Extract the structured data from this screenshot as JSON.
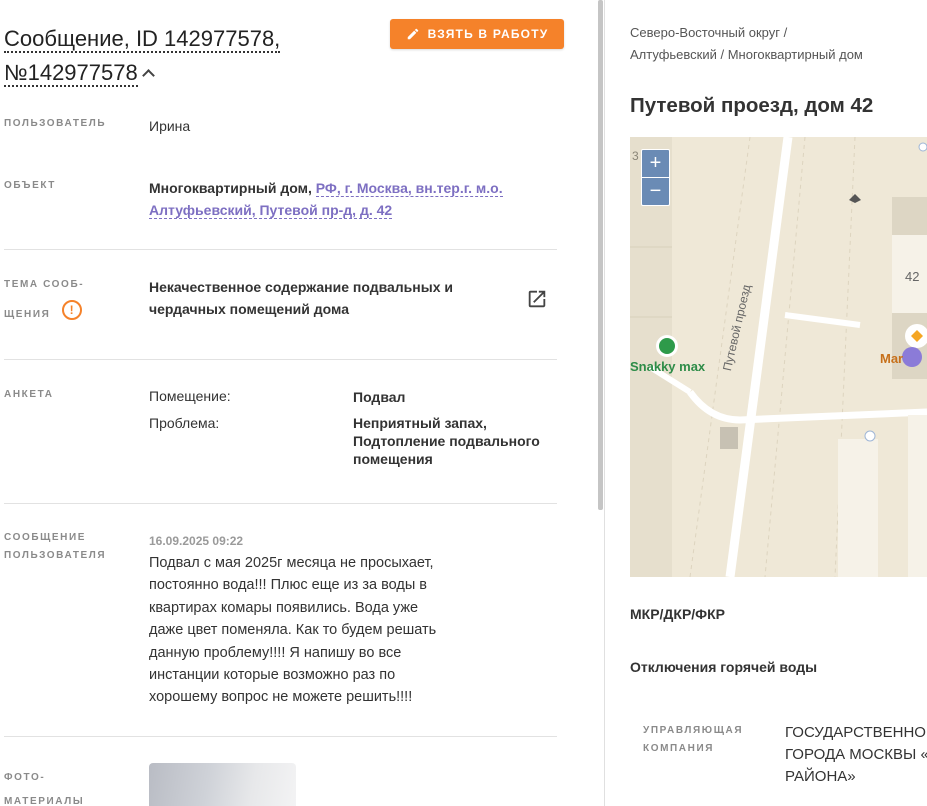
{
  "header": {
    "title_line1": "Сообщение, ID 142977578,",
    "title_line2": "№142977578",
    "take_button_label": "ВЗЯТЬ В РАБОТУ"
  },
  "fields": {
    "user_label": "ПОЛЬЗОВАТЕЛЬ",
    "user_value": "Ирина",
    "object_label": "ОБЪЕКТ",
    "object_type": "Многоквартирный дом,",
    "object_address_line1": "РФ, г. Москва, вн.тер.г. м.о.",
    "object_address_line2": "Алтуфьевский, Путевой пр-д, д. 42",
    "topic_label_line1": "ТЕМА СООБ-",
    "topic_label_line2": "ЩЕНИЯ",
    "topic_value_line1": "Некачественное содержание подвальных и",
    "topic_value_line2": "чердачных помещений дома",
    "anketa_label": "АНКЕТА",
    "anketa": [
      {
        "key": "Помещение:",
        "value": "Подвал"
      },
      {
        "key": "Проблема:",
        "value": "Неприятный запах, Подтопление подвального помещения"
      }
    ],
    "message_label_line1": "СООБЩЕНИЕ",
    "message_label_line2": "ПОЛЬЗОВАТЕЛЯ",
    "message_date": "16.09.2025 09:22",
    "message_text": "Подвал с мая 2025г месяца не просыхает, постоянно вода!!! Плюс еще из за воды в квартирах комары появились. Вода уже даже цвет поменяла. Как то будем решать данную проблему!!!! Я напишу во все инстанции которые возможно раз по хорошему вопрос не можете решить!!!!",
    "photo_label_line1": "ФОТО-",
    "photo_label_line2": "МАТЕРИАЛЫ"
  },
  "side": {
    "breadcrumb_line1": "Северо-Восточный округ /",
    "breadcrumb_line2": "Алтуфьевский / Многоквартирный дом",
    "address": "Путевой проезд, дом 42",
    "map": {
      "zoom_in": "+",
      "zoom_out": "−",
      "street_label": "Путевой проезд",
      "shop_label": "Snakky max",
      "building_number": "42",
      "store_label": "Mar",
      "edge_number": "3"
    },
    "section1": "МКР/ДКР/ФКР",
    "section2": "Отключения горячей воды",
    "uk_label_line1": "УПРАВЛЯЮЩАЯ",
    "uk_label_line2": "КОМПАНИЯ",
    "uk_value_line1": "ГОСУДАРСТВЕННОЕ",
    "uk_value_line2": "ГОРОДА МОСКВЫ «Ж",
    "uk_value_line3": "РАЙОНА»"
  },
  "colors": {
    "accent_orange": "#f5822a",
    "link_purple": "#7d6fc2",
    "map_bg": "#efe8d7"
  }
}
